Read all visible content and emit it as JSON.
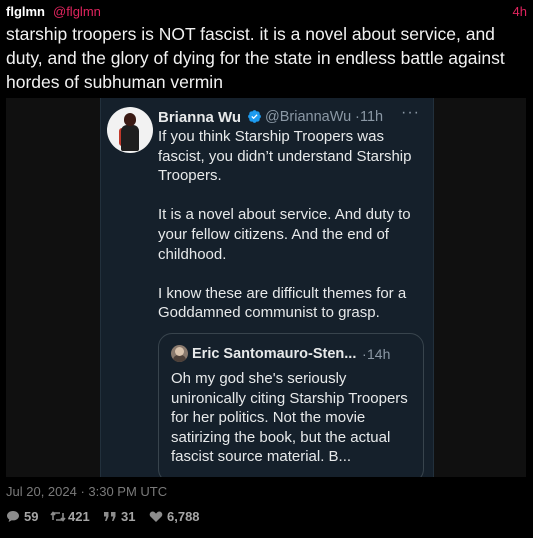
{
  "post": {
    "author_name": "flglmn",
    "author_handle": "@flglmn",
    "time": "4h",
    "text": "starship troopers is NOT fascist. it is a novel about service, and duty, and the glory of dying for the state in endless battle against hordes of subhuman vermin",
    "date": "Jul 20, 2024 · 3:30 PM UTC",
    "stats": {
      "replies": "59",
      "reposts": "421",
      "quotes": "31",
      "likes": "6,788"
    }
  },
  "embedded_tweet": {
    "name": "Brianna Wu",
    "handle": "@BriannaWu",
    "separator": "·",
    "time": "11h",
    "more": "···",
    "paragraphs": [
      "If you think Starship Troopers was fascist, you didn’t understand Starship Troopers.",
      "It is a novel about service. And duty to your fellow citizens. And the end of childhood.",
      "I know these are difficult themes for a Goddamned communist to grasp."
    ],
    "quoted": {
      "name": "Eric Santomauro-Sten...",
      "separator": "·",
      "time": "14h",
      "text": "Oh my god she's seriously unironically citing Starship Troopers for her politics. Not the movie satirizing the book, but the actual fascist source material. B..."
    }
  },
  "colors": {
    "accent": "#e0245e",
    "embed_background": "#15202b",
    "verified": "#1d9bf0"
  }
}
